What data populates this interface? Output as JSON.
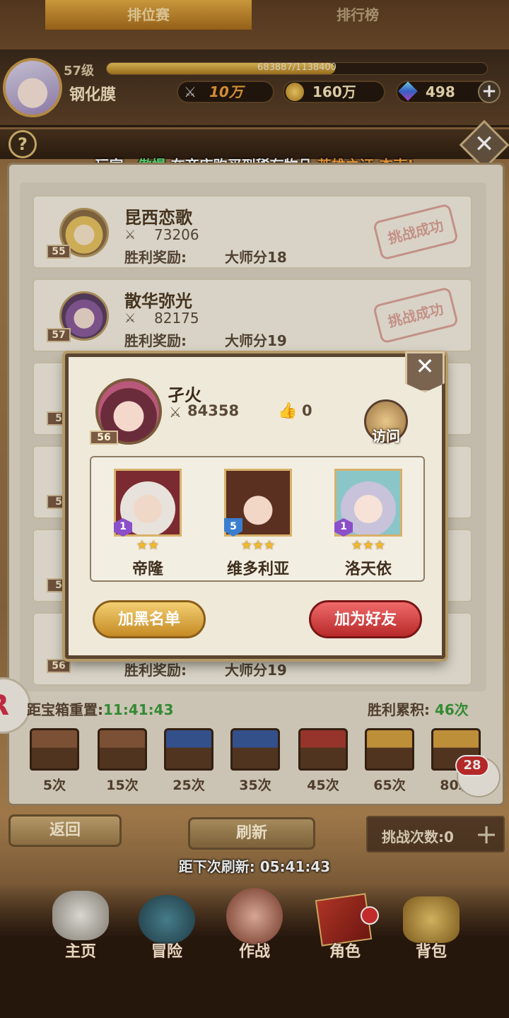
{
  "header": {
    "level": "57级",
    "exp_text": "683887/1138400",
    "exp_fraction": 0.6008,
    "player_name": "钢化膜",
    "power": "10万",
    "gold": "160万",
    "gems": "498"
  },
  "tabs": [
    {
      "label": "排位赛"
    },
    {
      "label": "排行榜"
    }
  ],
  "broadcast": {
    "prefix": "玩家",
    "sep": "、",
    "player": "傲慢",
    "middle": "在商店购买到稀有物品",
    "item": "英雄之证·杰克!"
  },
  "opponents": [
    {
      "level": "55",
      "name": "昆西恋歌",
      "power": "73206",
      "reward_label": "胜利奖励:",
      "reward": "大师分18",
      "stamp": "挑战成功"
    },
    {
      "level": "57",
      "name": "散华弥光",
      "power": "82175",
      "reward_label": "胜利奖励:",
      "reward": "大师分19",
      "stamp": "挑战成功"
    },
    {
      "level": "5"
    },
    {
      "level": "5"
    },
    {
      "level": "5"
    },
    {
      "level": "56",
      "reward_label": "胜利奖励:",
      "reward": "大师分19"
    }
  ],
  "chest_timer": {
    "label": "距宝箱重置:",
    "value": "11:41:43"
  },
  "wins": {
    "label": "胜利累积:",
    "value": "46次"
  },
  "chests": [
    {
      "count": "5次",
      "color": "#8a5a3a"
    },
    {
      "count": "15次",
      "color": "#8a5a3a"
    },
    {
      "count": "25次",
      "color": "#3a5a9a"
    },
    {
      "count": "35次",
      "color": "#3a5a9a"
    },
    {
      "count": "45次",
      "color": "#a83a30"
    },
    {
      "count": "65次",
      "color": "#d4a040"
    },
    {
      "count": "80次",
      "color": "#d4a040"
    }
  ],
  "chat_badge": "28",
  "buttons": {
    "back": "返回",
    "refresh": "刷新",
    "challenge_count": "挑战次数:0"
  },
  "refresh_timer": {
    "label": "距下次刷新:",
    "value": "05:41:43"
  },
  "nav": [
    {
      "label": "主页"
    },
    {
      "label": "冒险"
    },
    {
      "label": "作战"
    },
    {
      "label": "角色"
    },
    {
      "label": "背包"
    }
  ],
  "modal": {
    "name": "孑火",
    "level": "56",
    "power": "84358",
    "likes": "0",
    "visit_label": "访问",
    "heroes": [
      {
        "name": "帝隆",
        "stars": "★★",
        "badge": "1",
        "badge_color": "#8a4fc9"
      },
      {
        "name": "维多利亚",
        "stars": "★★★",
        "badge": "5",
        "badge_color": "#3a7ed0"
      },
      {
        "name": "洛天依",
        "stars": "★★★",
        "badge": "1",
        "badge_color": "#8a4fc9"
      }
    ],
    "blacklist_label": "加黑名单",
    "add_friend_label": "加为好友"
  }
}
